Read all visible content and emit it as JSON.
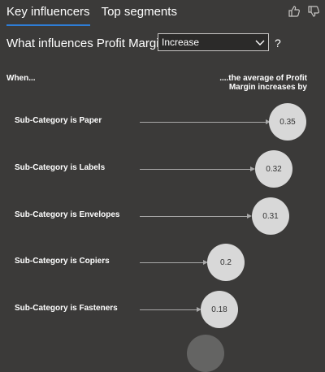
{
  "tabs": [
    {
      "label": "Key influencers",
      "active": true
    },
    {
      "label": "Top segments",
      "active": false
    }
  ],
  "icons": [
    "thumbs-up-icon",
    "thumbs-down-icon"
  ],
  "question": {
    "prefix": "What influences Profit Margin to",
    "selected": "Increase",
    "help": "?"
  },
  "columns": {
    "when": "When...",
    "average_line1": "....the average of Profit",
    "average_line2": "Margin increases by"
  },
  "influencers": [
    {
      "label": "Sub-Category is Paper",
      "value": "0.35"
    },
    {
      "label": "Sub-Category is Labels",
      "value": "0.32"
    },
    {
      "label": "Sub-Category is Envelopes",
      "value": "0.31"
    },
    {
      "label": "Sub-Category is Copiers",
      "value": "0.2"
    },
    {
      "label": "Sub-Category is Fasteners",
      "value": "0.18"
    }
  ],
  "colors": {
    "background": "#3b3a39",
    "accent": "#2e7dd6",
    "bubble": "#d8d8d8"
  }
}
